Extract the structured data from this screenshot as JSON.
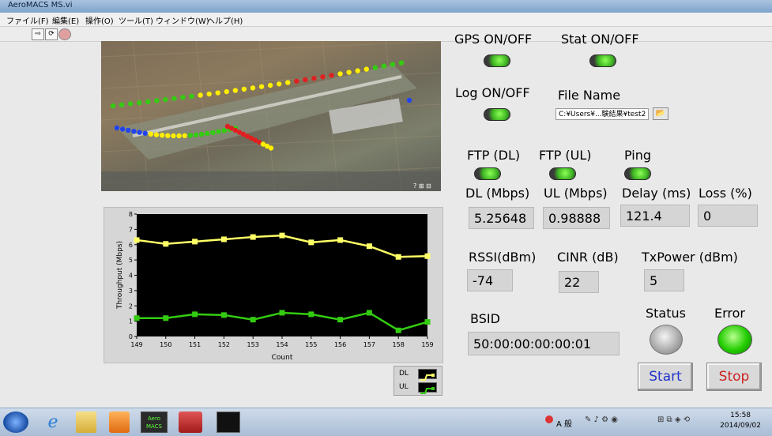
{
  "window": {
    "title": "AeroMACS MS.vi"
  },
  "menu": [
    "ファイル(F)",
    "編集(E)",
    "操作(O)",
    "ツール(T)",
    "ウィンドウ(W)",
    "ヘルプ(H)"
  ],
  "toggles": {
    "gps_label": "GPS ON/OFF",
    "stat_label": "Stat ON/OFF",
    "log_label": "Log ON/OFF",
    "file_name_label": "File Name",
    "file_path": "C:¥Users¥...験結果¥test2",
    "ftp_dl_label": "FTP (DL)",
    "ftp_ul_label": "FTP (UL)",
    "ping_label": "Ping"
  },
  "metrics": {
    "dl_label": "DL (Mbps)",
    "dl_value": "5.25648",
    "ul_label": "UL (Mbps)",
    "ul_value": "0.98888",
    "delay_label": "Delay (ms)",
    "delay_value": "121.4",
    "loss_label": "Loss (%)",
    "loss_value": "0",
    "rssi_label": "RSSI(dBm)",
    "rssi_value": "-74",
    "cinr_label": "CINR (dB)",
    "cinr_value": "22",
    "txpower_label": "TxPower (dBm)",
    "txpower_value": "5",
    "bsid_label": "BSID",
    "bsid_value": "50:00:00:00:00:01"
  },
  "indicators": {
    "status_label": "Status",
    "error_label": "Error"
  },
  "buttons": {
    "start": "Start",
    "stop": "Stop"
  },
  "legend": {
    "dl": "DL",
    "ul": "UL"
  },
  "taskbar": {
    "app_label_line1": "Aero",
    "app_label_line2": "MACS",
    "ime_text": "A 般",
    "clock_time": "15:58",
    "clock_date": "2014/09/02"
  },
  "colors": {
    "dl_series": "#ffff66",
    "ul_series": "#33cc11",
    "accent_start": "#2233cc",
    "accent_stop": "#cc2222"
  },
  "chart_data": {
    "type": "line",
    "xlabel": "Count",
    "ylabel": "Throughput (Mbps)",
    "x": [
      149,
      150,
      151,
      152,
      153,
      154,
      155,
      156,
      157,
      158,
      159
    ],
    "ylim": [
      0,
      8
    ],
    "yticks": [
      0,
      1,
      2,
      3,
      4,
      5,
      6,
      7,
      8
    ],
    "grid": false,
    "legend_position": "bottom-right",
    "series": [
      {
        "name": "DL",
        "values": [
          6.3,
          6.05,
          6.2,
          6.35,
          6.5,
          6.6,
          6.15,
          6.3,
          5.9,
          5.2,
          5.25
        ]
      },
      {
        "name": "UL",
        "values": [
          1.2,
          1.2,
          1.45,
          1.4,
          1.1,
          1.55,
          1.45,
          1.1,
          1.55,
          0.4,
          0.95
        ]
      }
    ]
  }
}
